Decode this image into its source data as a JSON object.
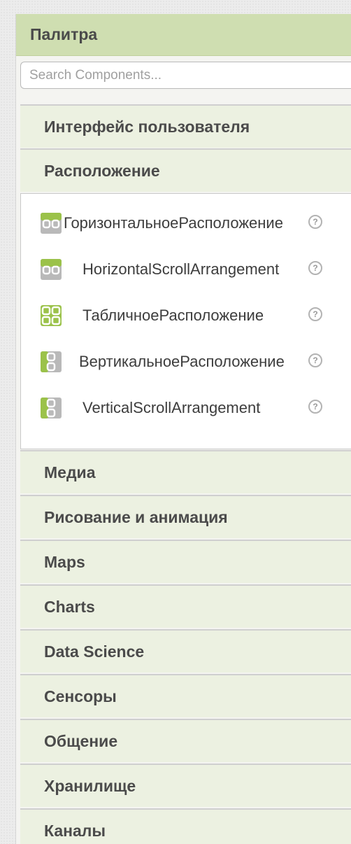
{
  "palette": {
    "title": "Палитра"
  },
  "search": {
    "placeholder": "Search Components..."
  },
  "categories_top": [
    {
      "label": "Интерфейс пользователя"
    },
    {
      "label": "Расположение"
    }
  ],
  "components": [
    {
      "label": "ГоризонтальноеРасположение",
      "icon": "horizontal-arrangement-icon"
    },
    {
      "label": "HorizontalScrollArrangement",
      "icon": "horizontal-scroll-arrangement-icon"
    },
    {
      "label": "ТабличноеРасположение",
      "icon": "table-arrangement-icon"
    },
    {
      "label": "ВертикальноеРасположение",
      "icon": "vertical-arrangement-icon"
    },
    {
      "label": "VerticalScrollArrangement",
      "icon": "vertical-scroll-arrangement-icon"
    }
  ],
  "help_glyph": "?",
  "categories_bottom": [
    {
      "label": "Медиа"
    },
    {
      "label": "Рисование и анимация"
    },
    {
      "label": "Maps"
    },
    {
      "label": "Charts"
    },
    {
      "label": "Data Science"
    },
    {
      "label": "Сенсоры"
    },
    {
      "label": "Общение"
    },
    {
      "label": "Хранилище"
    },
    {
      "label": "Каналы"
    }
  ],
  "colors": {
    "header_bg": "#cfdeb1",
    "category_bg": "#ecf1e1",
    "icon_green": "#9bc24a",
    "icon_gray": "#b9b9b9"
  }
}
